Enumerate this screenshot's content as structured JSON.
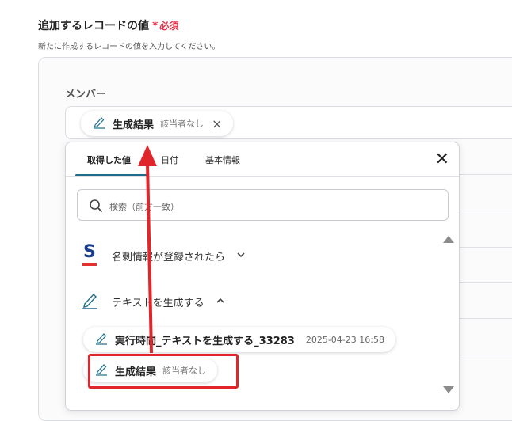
{
  "section": {
    "title": "追加するレコードの値",
    "required_star": "*",
    "required_text": "必須",
    "description": "新たに作成するレコードの値を入力してください。"
  },
  "member_field": {
    "label": "メンバー",
    "chip": {
      "label": "生成結果",
      "status": "該当者なし",
      "remove_icon": "×",
      "icon": "pen-icon"
    }
  },
  "popup": {
    "tabs": [
      {
        "label": "取得した値",
        "active": true
      },
      {
        "label": "日付",
        "active": false
      },
      {
        "label": "基本情報",
        "active": false
      }
    ],
    "close_label": "✕",
    "search_placeholder": "検索（前方一致）",
    "groups": [
      {
        "label": "名刺情報が登録されたら",
        "icon": "sansan-logo-icon",
        "expanded": false,
        "chevron": "⌄"
      },
      {
        "label": "テキストを生成する",
        "icon": "pen-icon",
        "expanded": true,
        "chevron": "⌃"
      }
    ],
    "items": [
      {
        "label": "実行時間_テキストを生成する_33283",
        "value": "2025-04-23 16:58",
        "icon": "pen-icon"
      },
      {
        "label": "生成結果",
        "value": "該当者なし",
        "icon": "pen-icon"
      }
    ]
  },
  "colors": {
    "accent_tab": "#1d6c8a",
    "required": "#e8334a",
    "annotation_red": "#e0262a",
    "sansan_blue": "#1a3e8c",
    "sansan_red": "#e3312d"
  }
}
